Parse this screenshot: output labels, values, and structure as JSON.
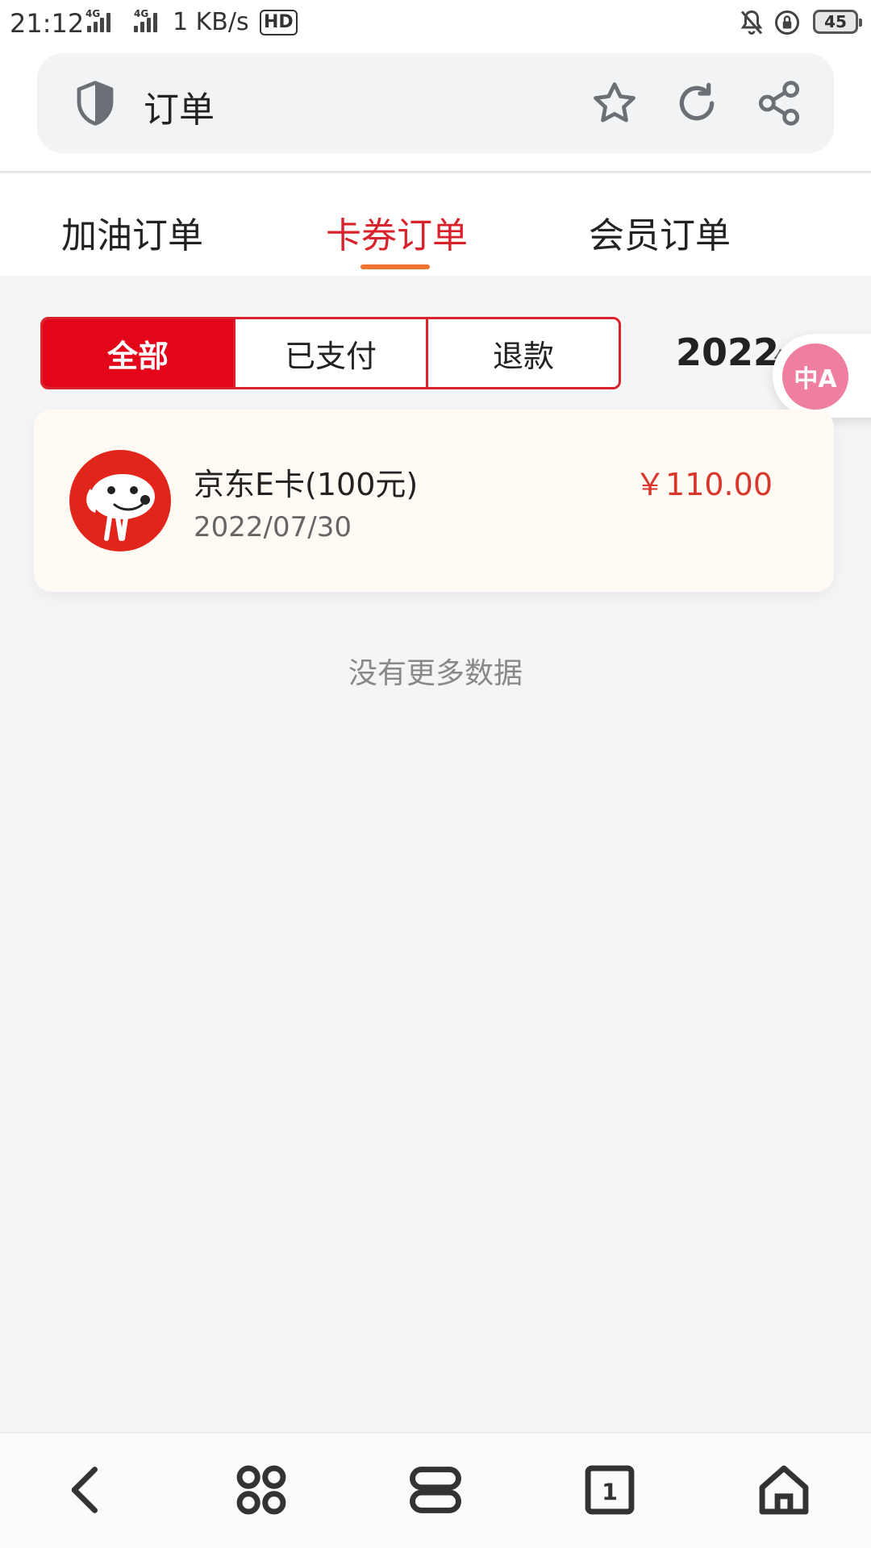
{
  "status_bar": {
    "time": "21:12",
    "network_speed": "1 KB/s",
    "signal1_label": "4G",
    "signal2_label": "4G",
    "hd_label": "HD",
    "battery_level": "45"
  },
  "browser": {
    "page_title": "订单",
    "icons": [
      "shield-icon",
      "star-icon",
      "refresh-icon",
      "share-icon"
    ]
  },
  "tabs": [
    {
      "label": "加油订单",
      "active": false
    },
    {
      "label": "卡券订单",
      "active": true
    },
    {
      "label": "会员订单",
      "active": false
    }
  ],
  "filters": [
    {
      "label": "全部",
      "active": true
    },
    {
      "label": "已支付",
      "active": false
    },
    {
      "label": "退款",
      "active": false
    }
  ],
  "year_picker": {
    "year": "2022",
    "suffix": "年"
  },
  "translate_fab": {
    "label": "中A"
  },
  "orders": [
    {
      "title": "京东E卡(100元)",
      "date": "2022/07/30",
      "price": "￥110.00",
      "logo_icon": "jd-dog-logo-icon"
    }
  ],
  "list_footer": "没有更多数据",
  "bottom_nav": [
    "back-icon",
    "menu-grid-icon",
    "windows-icon",
    "tabs-count-icon",
    "home-icon"
  ],
  "tabs_count": "1",
  "colors": {
    "accent_red": "#e3051a",
    "tab_underline": "#f07430",
    "price_red": "#d9362c"
  }
}
